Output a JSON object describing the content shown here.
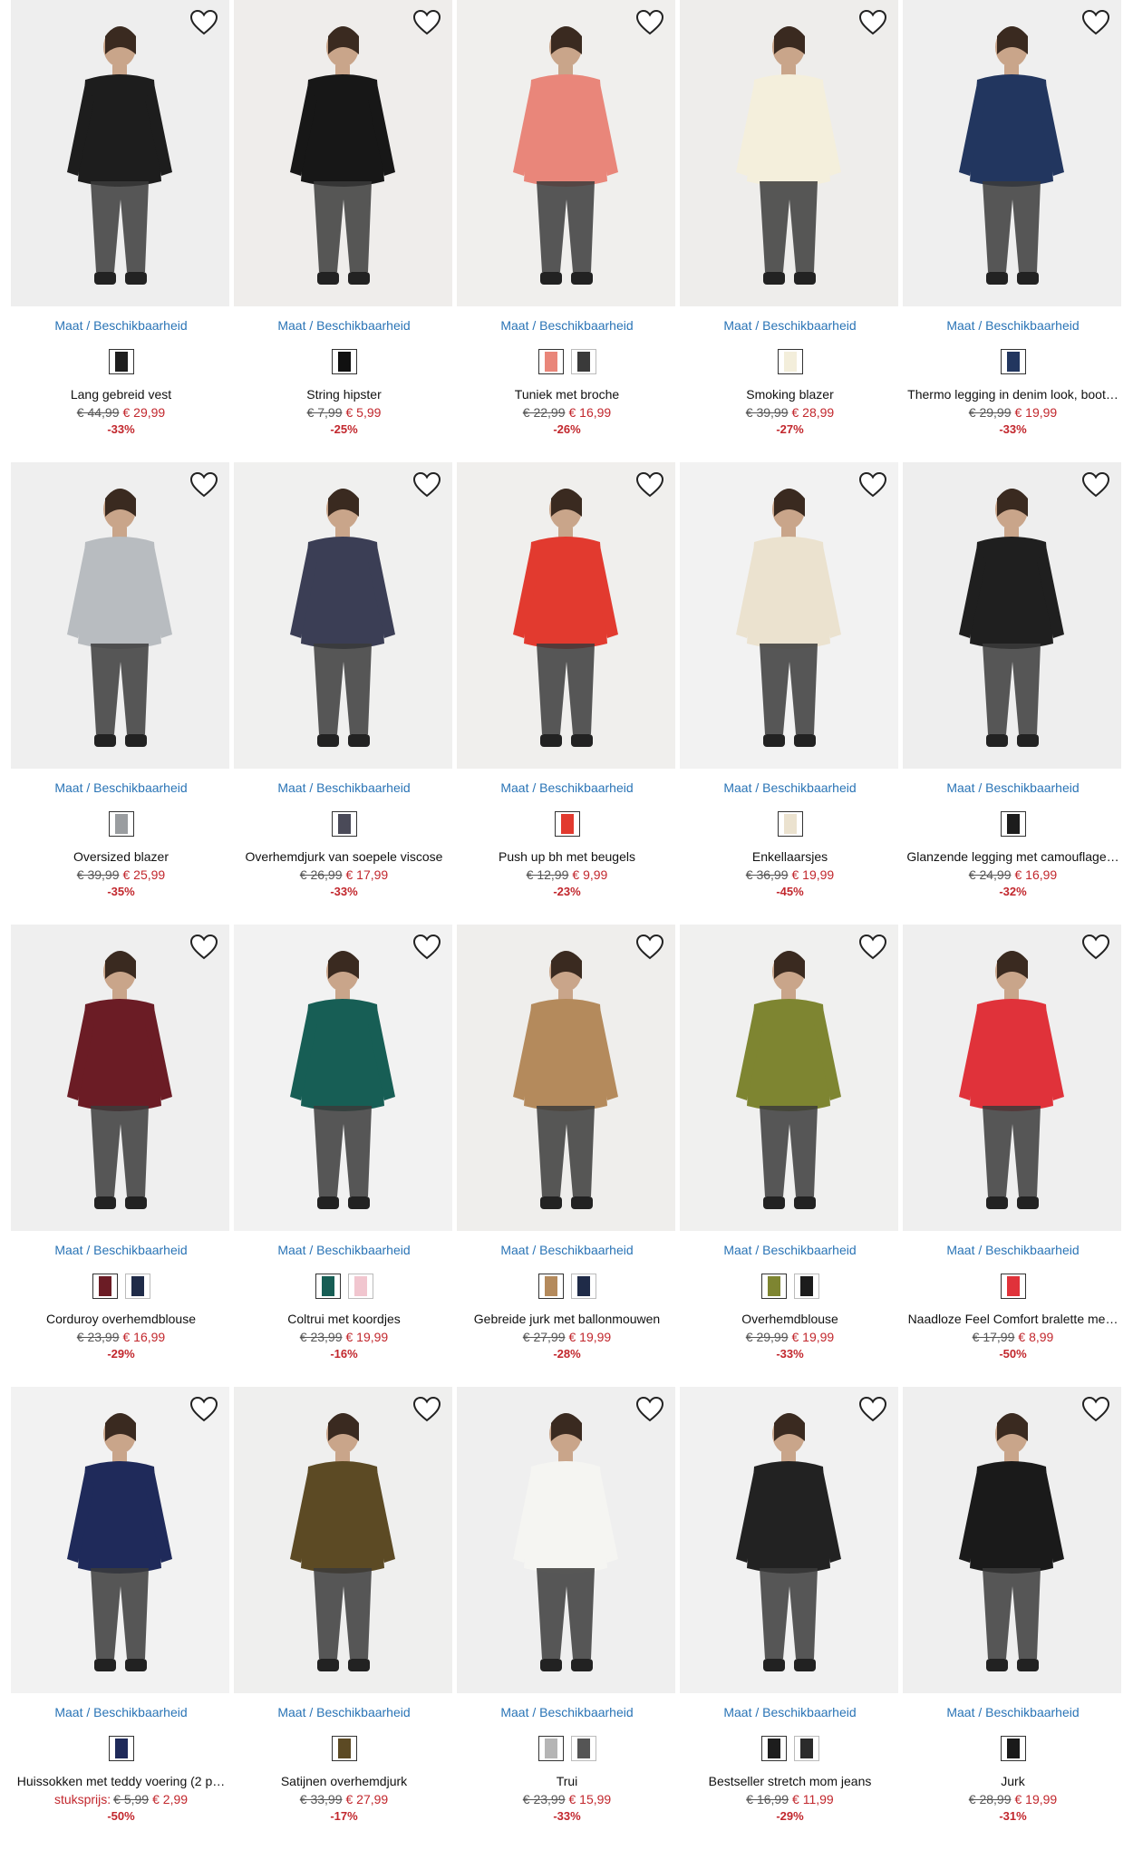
{
  "ui": {
    "size_link_label": "Maat / Beschikbaarheid",
    "wishlist_icon": "heart-outline-icon"
  },
  "products": [
    {
      "title": "Lang gebreid vest",
      "old_price": "€ 44,99",
      "new_price": "€ 29,99",
      "discount": "-33%",
      "bg": "#eeeeee",
      "colors": [
        "#1d1d1d"
      ],
      "swatch_colors": [
        "#1e1e1e"
      ]
    },
    {
      "title": "String hipster",
      "old_price": "€ 7,99",
      "new_price": "€ 5,99",
      "discount": "-25%",
      "bg": "#efedeb",
      "colors": [
        "#171717"
      ],
      "swatch_colors": [
        "#111111"
      ]
    },
    {
      "title": "Tuniek met broche",
      "old_price": "€ 22,99",
      "new_price": "€ 16,99",
      "discount": "-26%",
      "bg": "#f0efed",
      "colors": [
        "#e9867a"
      ],
      "swatch_colors": [
        "#e9867a",
        "#3a3a3a"
      ]
    },
    {
      "title": "Smoking blazer",
      "old_price": "€ 39,99",
      "new_price": "€ 28,99",
      "discount": "-27%",
      "bg": "#eeedeb",
      "colors": [
        "#f4efdc"
      ],
      "swatch_colors": [
        "#f3eedb"
      ]
    },
    {
      "title": "Thermo legging in denim look, boot…",
      "old_price": "€ 29,99",
      "new_price": "€ 19,99",
      "discount": "-33%",
      "bg": "#efefef",
      "colors": [
        "#22365f"
      ],
      "swatch_colors": [
        "#22365f"
      ]
    },
    {
      "title": "Oversized blazer",
      "old_price": "€ 39,99",
      "new_price": "€ 25,99",
      "discount": "-35%",
      "bg": "#efefef",
      "colors": [
        "#b8bcc0"
      ],
      "swatch_colors": [
        "#9a9da0"
      ]
    },
    {
      "title": "Overhemdjurk van soepele viscose",
      "old_price": "€ 26,99",
      "new_price": "€ 17,99",
      "discount": "-33%",
      "bg": "#f0f0ef",
      "colors": [
        "#3b3e55"
      ],
      "swatch_colors": [
        "#4a4a58"
      ]
    },
    {
      "title": "Push up bh met beugels",
      "old_price": "€ 12,99",
      "new_price": "€ 9,99",
      "discount": "-23%",
      "bg": "#f0efed",
      "colors": [
        "#e23a2f"
      ],
      "swatch_colors": [
        "#e23a2f"
      ]
    },
    {
      "title": "Enkellaarsjes",
      "old_price": "€ 36,99",
      "new_price": "€ 19,99",
      "discount": "-45%",
      "bg": "#f2f2f2",
      "colors": [
        "#ebe2cf"
      ],
      "swatch_colors": [
        "#ebe2cf"
      ]
    },
    {
      "title": "Glanzende legging met camouflage…",
      "old_price": "€ 24,99",
      "new_price": "€ 16,99",
      "discount": "-32%",
      "bg": "#eeeeee",
      "colors": [
        "#1f1f1f"
      ],
      "swatch_colors": [
        "#1c1c1c"
      ]
    },
    {
      "title": "Corduroy overhemdblouse",
      "old_price": "€ 23,99",
      "new_price": "€ 16,99",
      "discount": "-29%",
      "bg": "#efefef",
      "colors": [
        "#6b1c25"
      ],
      "swatch_colors": [
        "#6b1c25",
        "#1f2b48"
      ]
    },
    {
      "title": "Coltrui met koordjes",
      "old_price": "€ 23,99",
      "new_price": "€ 19,99",
      "discount": "-16%",
      "bg": "#f2f2f2",
      "colors": [
        "#175e55"
      ],
      "swatch_colors": [
        "#175e55",
        "#f1c6cf"
      ]
    },
    {
      "title": "Gebreide jurk met ballonmouwen",
      "old_price": "€ 27,99",
      "new_price": "€ 19,99",
      "discount": "-28%",
      "bg": "#efeeec",
      "colors": [
        "#b48a5c"
      ],
      "swatch_colors": [
        "#b48a5c",
        "#1f2b48"
      ]
    },
    {
      "title": "Overhemdblouse",
      "old_price": "€ 29,99",
      "new_price": "€ 19,99",
      "discount": "-33%",
      "bg": "#f0f0ef",
      "colors": [
        "#7e8531"
      ],
      "swatch_colors": [
        "#7e8531",
        "#1c1c1c"
      ]
    },
    {
      "title": "Naadloze Feel Comfort bralette me…",
      "old_price": "€ 17,99",
      "new_price": "€ 8,99",
      "discount": "-50%",
      "bg": "#efefef",
      "colors": [
        "#e0323a"
      ],
      "swatch_colors": [
        "#e0323a"
      ]
    },
    {
      "title": "Huissokken met teddy voering (2 p…",
      "unit_label": "stuksprijs:",
      "old_price": "€ 5,99",
      "new_price": "€ 2,99",
      "discount": "-50%",
      "bg": "#f2f2f2",
      "colors": [
        "#1f2a5a"
      ],
      "swatch_colors": [
        "#1f2a5a"
      ]
    },
    {
      "title": "Satijnen overhemdjurk",
      "old_price": "€ 33,99",
      "new_price": "€ 27,99",
      "discount": "-17%",
      "bg": "#efefee",
      "colors": [
        "#5c4a24"
      ],
      "swatch_colors": [
        "#5c4a24"
      ]
    },
    {
      "title": "Trui",
      "old_price": "€ 23,99",
      "new_price": "€ 15,99",
      "discount": "-33%",
      "bg": "#efefef",
      "colors": [
        "#f5f5f2"
      ],
      "swatch_colors": [
        "#b5b5b5",
        "#555555"
      ]
    },
    {
      "title": "Bestseller stretch mom jeans",
      "old_price": "€ 16,99",
      "new_price": "€ 11,99",
      "discount": "-29%",
      "bg": "#f1f1f1",
      "colors": [
        "#222222"
      ],
      "swatch_colors": [
        "#1d1d1d",
        "#2b2b2b"
      ]
    },
    {
      "title": "Jurk",
      "old_price": "€ 28,99",
      "new_price": "€ 19,99",
      "discount": "-31%",
      "bg": "#efefef",
      "colors": [
        "#1a1a1a"
      ],
      "swatch_colors": [
        "#1a1a1a"
      ]
    }
  ]
}
